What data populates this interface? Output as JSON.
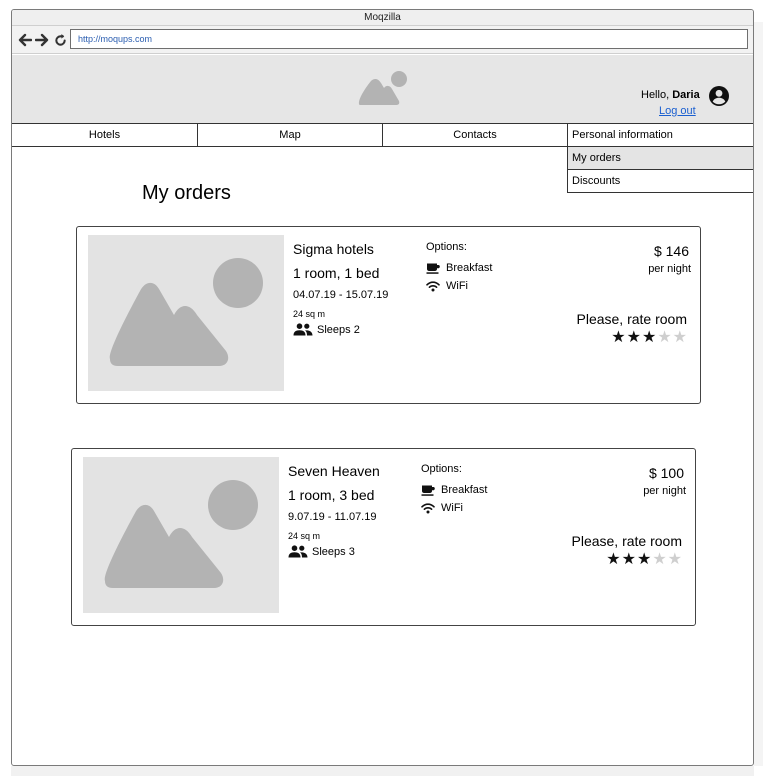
{
  "browser": {
    "title": "Moqzilla",
    "url": "http://moqups.com"
  },
  "header": {
    "greeting": "Hello, ",
    "user_name": "Daria",
    "logout_label": "Log out"
  },
  "navbar": {
    "items": [
      {
        "label": "Hotels"
      },
      {
        "label": "Map"
      },
      {
        "label": "Contacts"
      }
    ]
  },
  "dropdown": {
    "items": [
      {
        "label": "Personal information",
        "active": false
      },
      {
        "label": "My orders",
        "active": true
      },
      {
        "label": "Discounts",
        "active": false
      }
    ]
  },
  "page": {
    "title": "My orders"
  },
  "orders": [
    {
      "hotel": "Sigma hotels",
      "room": "1 room, 1 bed",
      "dates": "04.07.19 - 15.07.19",
      "size": "24 sq m",
      "sleeps": "Sleeps 2",
      "options_title": "Options:",
      "options": [
        "Breakfast",
        "WiFi"
      ],
      "price": "$ 146",
      "per_night": "per night",
      "rate_label": "Please, rate room",
      "rating": 3,
      "max_rating": 5
    },
    {
      "hotel": "Seven Heaven",
      "room": "1 room, 3 bed",
      "dates": "9.07.19 - 11.07.19",
      "size": "24 sq m",
      "sleeps": "Sleeps 3",
      "options_title": "Options:",
      "options": [
        "Breakfast",
        "WiFi"
      ],
      "price": "$ 100",
      "per_night": "per night",
      "rate_label": "Please, rate room",
      "rating": 3,
      "max_rating": 5
    }
  ],
  "colors": {
    "header_bg": "#e6e6e6",
    "placeholder_bg": "#e3e3e3",
    "placeholder_shape": "#b3b3b3",
    "link": "#1a5fd0"
  }
}
